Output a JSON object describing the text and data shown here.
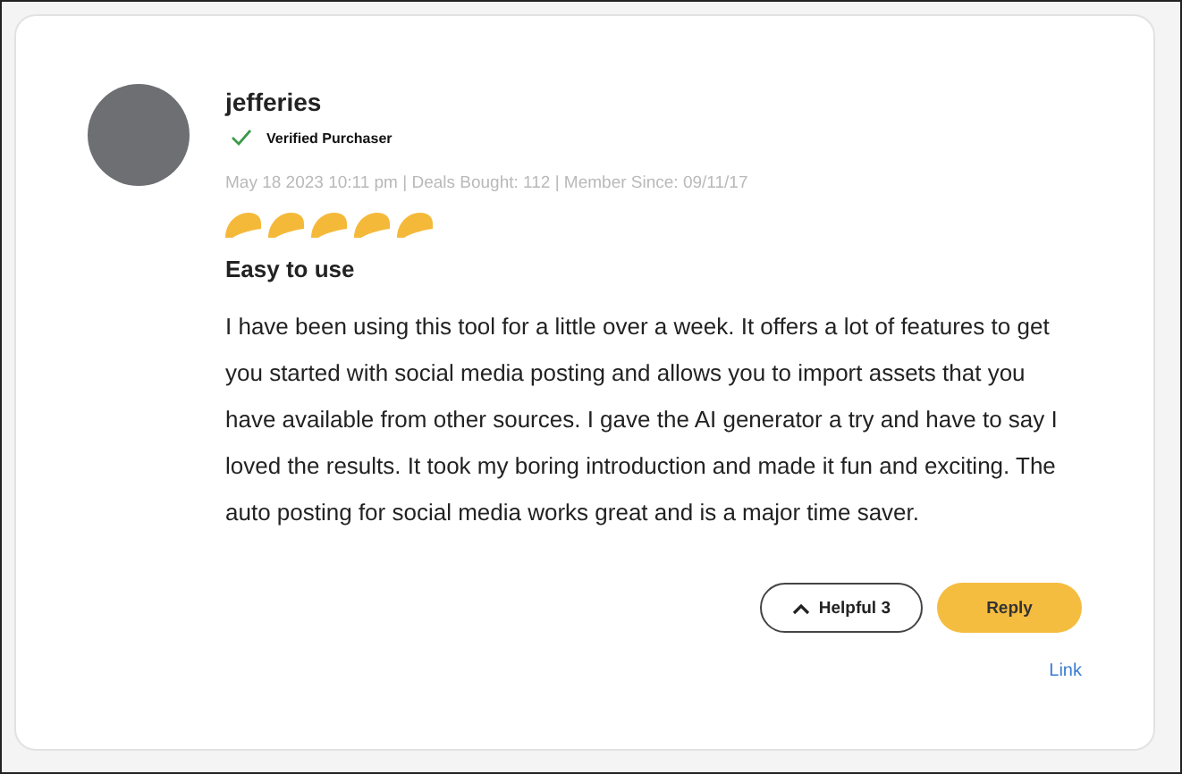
{
  "review": {
    "author": "jefferies",
    "badge": "Verified Purchaser",
    "meta": "May 18 2023 10:11 pm | Deals Bought: 112 | Member Since: 09/11/17",
    "stars": 5,
    "title": "Easy to use",
    "body": "I have been using this tool for a little over a week. It offers a lot of features to get you started with social media posting and allows you to import assets that you have available from other sources. I gave the AI generator a try and have to say I loved the results. It took my boring introduction and made it fun and exciting. The auto posting for social media works great and is a major time saver.",
    "helpful": "Helpful 3",
    "reply": "Reply",
    "link": "Link"
  }
}
